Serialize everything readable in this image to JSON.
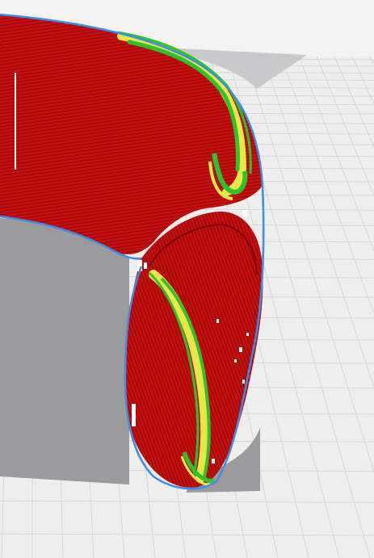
{
  "viewer": {
    "view_mode": "layer-preview",
    "colors": {
      "background": "#f3f3f4",
      "build_plate": "#eeeeef",
      "grid_line": "#d6d6d8",
      "shadow": "#9a9a9c",
      "wall_outer": "#c80f0f",
      "wall_inner": "#a80a0a",
      "skin": "#e7e845",
      "infill": "#2fc22f",
      "support": "#ffffff",
      "outline": "#3a8ee6"
    },
    "icons": {
      "model": "print-model-icon",
      "build_plate": "build-plate-icon"
    }
  }
}
